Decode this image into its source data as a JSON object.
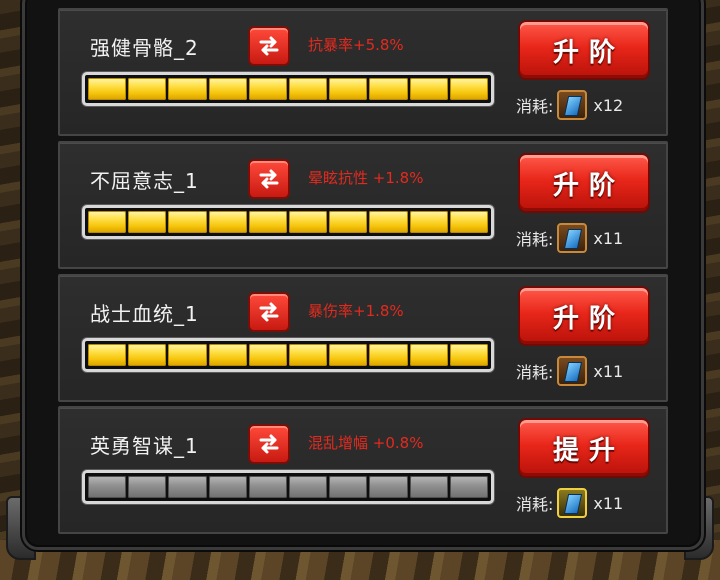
{
  "cost_label": "消耗:",
  "skills": [
    {
      "name": "强健骨骼_2",
      "effect": "抗暴率+5.8%",
      "progress_filled": 10,
      "progress_total": 10,
      "action": "升阶",
      "cost_count": "x12",
      "icon": "skill-book-icon"
    },
    {
      "name": "不屈意志_1",
      "effect": "晕眩抗性 +1.8%",
      "progress_filled": 10,
      "progress_total": 10,
      "action": "升阶",
      "cost_count": "x11",
      "icon": "skill-book-icon"
    },
    {
      "name": "战士血统_1",
      "effect": "暴伤率+1.8%",
      "progress_filled": 10,
      "progress_total": 10,
      "action": "升阶",
      "cost_count": "x11",
      "icon": "skill-book-icon"
    },
    {
      "name": "英勇智谋_1",
      "effect": "混乱增幅 +0.8%",
      "progress_filled": 0,
      "progress_total": 10,
      "action": "提升",
      "cost_count": "x11",
      "icon": "skill-book-icon-gold"
    }
  ],
  "colors": {
    "effect_text": "#e32a1e",
    "button_red": "#e8261a",
    "bar_gold": "#ffe04a",
    "bar_empty": "#8f8f8f"
  }
}
